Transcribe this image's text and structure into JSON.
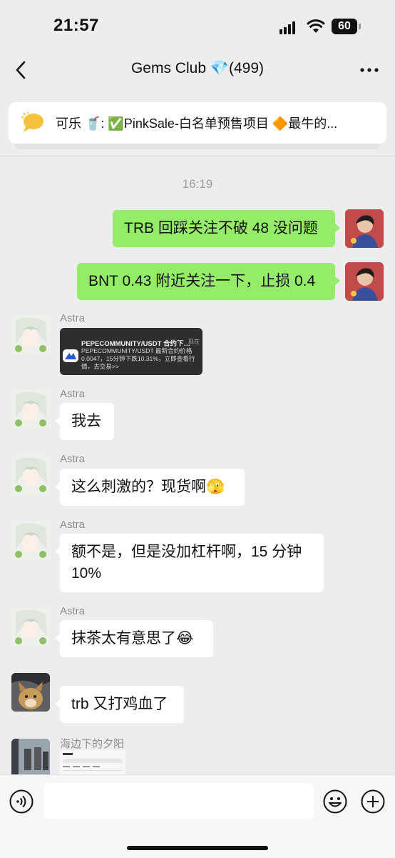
{
  "status_bar": {
    "time": "21:57",
    "battery": "60"
  },
  "header": {
    "title": "Gems Club 💎(499)"
  },
  "pinned": {
    "text": "可乐 🥤: ✅PinkSale-白名单预售项目 🔶最牛的..."
  },
  "timestamp": "16:19",
  "messages": {
    "m1": {
      "text": "TRB 回踩关注不破 48 没问题"
    },
    "m2": {
      "text": "BNT 0.43 附近关注一下，止损 0.4"
    },
    "m3": {
      "sender": "Astra",
      "card_title": "PEPECOMMUNITY/USDT 合约下…",
      "card_time": "现在",
      "card_body": "PEPECOMMUNITY/USDT 最新合约价格0.0047，15分钟下跌10.31%，立即查看行情，去交易>>"
    },
    "m4": {
      "sender": "Astra",
      "text": "我去"
    },
    "m5": {
      "sender": "Astra",
      "text": "这么刺激的？现货啊🫣"
    },
    "m6": {
      "sender": "Astra",
      "text_line1": "额不是，但是没加杠杆啊，15 分钟",
      "text_line2": "10%"
    },
    "m7": {
      "sender": "Astra",
      "text": "抹茶太有意思了😂"
    },
    "m8": {
      "text": "trb 又打鸡血了"
    },
    "m9": {
      "sender": "海边下的夕阳"
    }
  },
  "colors": {
    "sent_bubble": "#95ec69",
    "received_bubble": "#ffffff",
    "background": "#ededed"
  },
  "icons": [
    "back-chevron-icon",
    "more-dots-icon",
    "speech-bubble-icon",
    "voice-icon",
    "emoji-icon",
    "plus-icon"
  ]
}
